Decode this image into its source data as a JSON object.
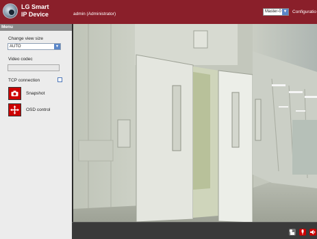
{
  "header": {
    "brand_line1": "LG Smart",
    "brand_line2": "IP Device",
    "user": "admin (Administrator)",
    "stream_selected": "Master-0",
    "config_label": "Configuratio",
    "accent_color": "#8a1f2a"
  },
  "sidebar": {
    "menu_title": "Menu",
    "view_size_label": "Change view size",
    "view_size_value": "AUTO",
    "codec_label": "Video codec",
    "codec_value": "",
    "tcp_label": "TCP connection",
    "snapshot_label": "Snapshot",
    "osd_label": "OSD control",
    "snapshot_icon": "camera-icon",
    "osd_icon": "move-arrows-icon"
  },
  "controls": {
    "icons": [
      "ptz-icon",
      "microphone-icon",
      "speaker-icon"
    ]
  }
}
